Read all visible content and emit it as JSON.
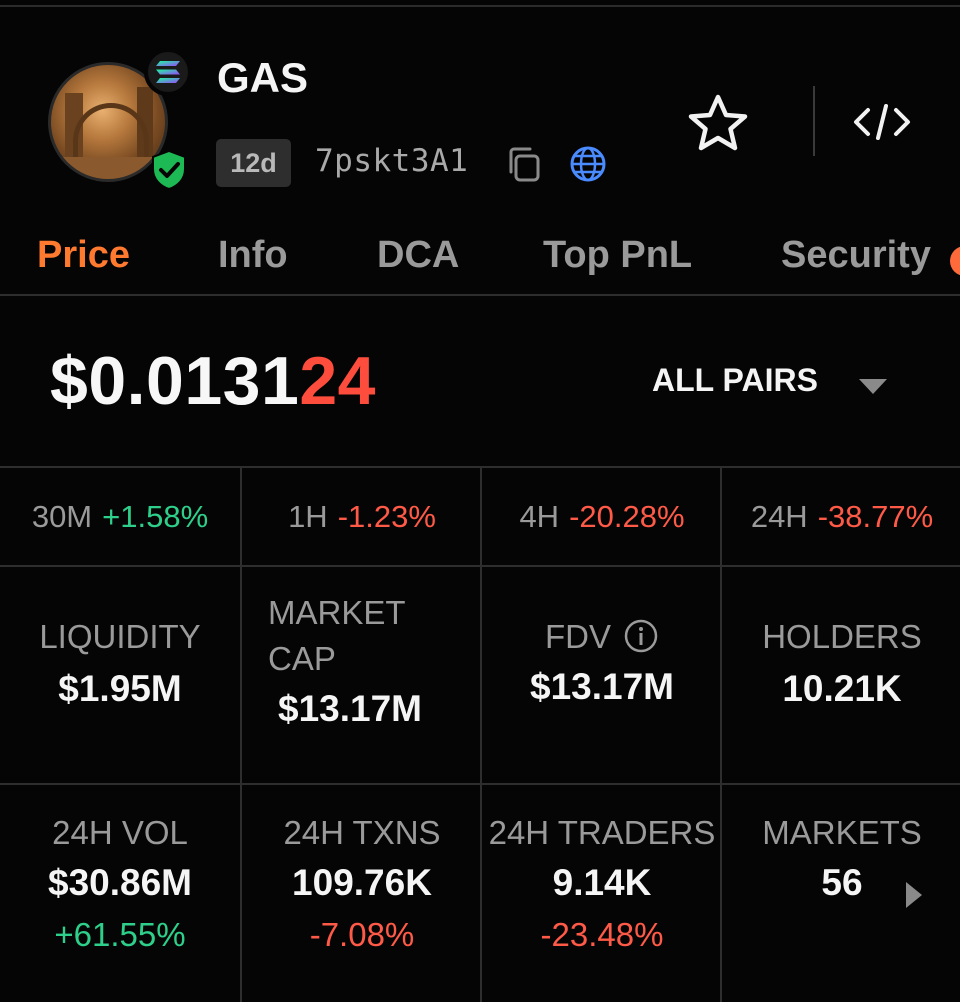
{
  "token": {
    "name": "GAS",
    "age": "12d",
    "address": "7pskt3A1"
  },
  "tabs": [
    {
      "label": "Price",
      "active": true
    },
    {
      "label": "Info"
    },
    {
      "label": "DCA"
    },
    {
      "label": "Top PnL"
    },
    {
      "label": "Security"
    }
  ],
  "price": {
    "main": "$0.0131",
    "tail": "24"
  },
  "pairs_selector": {
    "label": "ALL PAIRS"
  },
  "changes": [
    {
      "period": "30M",
      "value": "+1.58%",
      "direction": "up"
    },
    {
      "period": "1H",
      "value": "-1.23%",
      "direction": "down"
    },
    {
      "period": "4H",
      "value": "-20.28%",
      "direction": "down"
    },
    {
      "period": "24H",
      "value": "-38.77%",
      "direction": "down"
    }
  ],
  "stats_row1": [
    {
      "label": "LIQUIDITY",
      "value": "$1.95M"
    },
    {
      "label_line1": "MARKET",
      "label_line2": "CAP",
      "value": "$13.17M"
    },
    {
      "label": "FDV",
      "value": "$13.17M"
    },
    {
      "label": "HOLDERS",
      "value": "10.21K"
    }
  ],
  "stats_row2": [
    {
      "label": "24H VOL",
      "value": "$30.86M",
      "delta": "+61.55%"
    },
    {
      "label": "24H TXNS",
      "value": "109.76K",
      "delta": "-7.08%"
    },
    {
      "label": "24H TRADERS",
      "value": "9.14K",
      "delta": "-23.48%"
    },
    {
      "label": "MARKETS",
      "value": "56"
    }
  ],
  "icons": {
    "chain": "solana-icon",
    "verified": "verified-shield-icon",
    "copy": "copy-icon",
    "website": "globe-icon",
    "favorite": "star-icon",
    "embed": "code-icon",
    "info": "info-icon",
    "dropdown": "caret-down-icon",
    "more": "chevron-right-icon"
  },
  "colors": {
    "accent": "#ff7a2f",
    "positive": "#2ecf8a",
    "negative": "#ff5a47",
    "background": "#050505",
    "verified": "#1db954",
    "globe": "#4a8cff"
  }
}
